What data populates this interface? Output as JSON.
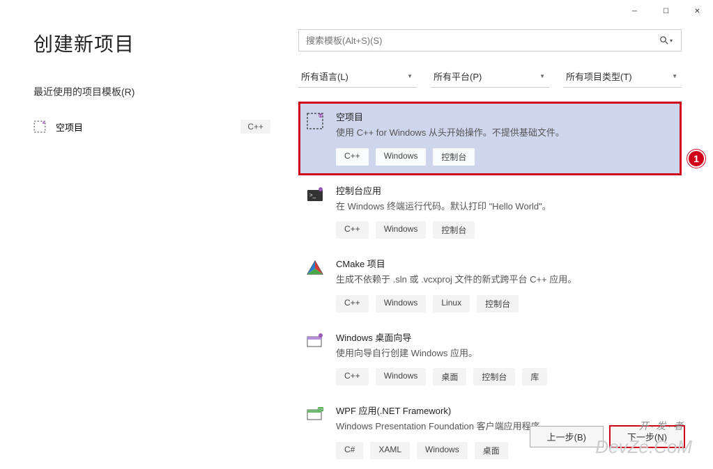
{
  "window_controls": {
    "min": "─",
    "max": "☐",
    "close": "✕"
  },
  "title": "创建新项目",
  "recent_heading": "最近使用的项目模板(R)",
  "recent": [
    {
      "name": "空项目",
      "tag": "C++"
    }
  ],
  "search_placeholder": "搜索模板(Alt+S)(S)",
  "filters": [
    {
      "label": "所有语言(L)"
    },
    {
      "label": "所有平台(P)"
    },
    {
      "label": "所有项目类型(T)"
    }
  ],
  "templates": [
    {
      "title": "空项目",
      "desc": "使用 C++ for Windows 从头开始操作。不提供基础文件。",
      "tags": [
        "C++",
        "Windows",
        "控制台"
      ],
      "selected": true
    },
    {
      "title": "控制台应用",
      "desc": "在 Windows 终端运行代码。默认打印 \"Hello World\"。",
      "tags": [
        "C++",
        "Windows",
        "控制台"
      ]
    },
    {
      "title": "CMake 项目",
      "desc": "生成不依赖于 .sln 或 .vcxproj 文件的新式跨平台 C++ 应用。",
      "tags": [
        "C++",
        "Windows",
        "Linux",
        "控制台"
      ]
    },
    {
      "title": "Windows 桌面向导",
      "desc": "使用向导自行创建 Windows 应用。",
      "tags": [
        "C++",
        "Windows",
        "桌面",
        "控制台",
        "库"
      ]
    },
    {
      "title": "WPF 应用(.NET Framework)",
      "desc": "Windows Presentation Foundation 客户端应用程序",
      "tags": [
        "C#",
        "XAML",
        "Windows",
        "桌面"
      ]
    }
  ],
  "callout_number": "1",
  "back_btn": "上一步(B)",
  "next_btn": "下一步(N)",
  "watermark": "DevZe.CoM",
  "watermark2": "开·发·者"
}
